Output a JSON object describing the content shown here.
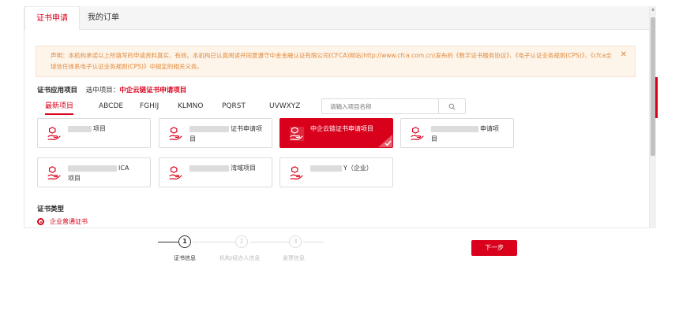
{
  "tabs": [
    {
      "label": "证书申请",
      "active": true
    },
    {
      "label": "我的订单",
      "active": false
    }
  ],
  "notice": {
    "text": "声明：本机构承诺以上所填写的申请资料真实、有效。本机构已认真阅读并同意遵守中金金融认证有限公司(CFCA)网站(http://www.cfca.com.cn)发布的《数字证书服务协议》、《电子认证业务规则(CPS)》、《cfca全球信任体系电子认证业务规则(CPS)》中规定的相关义务。",
    "close_icon": "close-icon"
  },
  "project": {
    "label": "证书应用项目",
    "selected_prefix": "选中项目：",
    "selected_value": "中企云链证书申请项目"
  },
  "letters": [
    {
      "label": "最新项目",
      "active": true
    },
    {
      "label": "ABCDE",
      "active": false
    },
    {
      "label": "FGHIJ",
      "active": false
    },
    {
      "label": "KLMNO",
      "active": false
    },
    {
      "label": "PQRST",
      "active": false
    },
    {
      "label": "UVWXYZ",
      "active": false
    }
  ],
  "search": {
    "placeholder": "请输入项目名称",
    "icon": "search-icon"
  },
  "cards": [
    {
      "line1": "项目",
      "line2": "",
      "selected": false
    },
    {
      "line1": "证书申请项",
      "line2": "目",
      "selected": false
    },
    {
      "line1": "中企云链证书申请项目",
      "line2": "",
      "selected": true
    },
    {
      "line1": "申请项",
      "line2": "目",
      "selected": false
    },
    {
      "line1": "ICA",
      "line2": "项目",
      "selected": false
    },
    {
      "line1": "湾域项目",
      "line2": "",
      "selected": false
    },
    {
      "line1": "Y（企业）",
      "line2": "",
      "selected": false
    }
  ],
  "cert_type": {
    "title": "证书类型",
    "option": "企业普通证书"
  },
  "steps": [
    {
      "num": "1",
      "label": "证书信息",
      "active": true
    },
    {
      "num": "2",
      "label": "机构/经办人信息",
      "active": false
    },
    {
      "num": "3",
      "label": "发票信息",
      "active": false
    }
  ],
  "next_button": "下一步",
  "colors": {
    "accent": "#d9001b",
    "notice_bg": "#fdf4ea",
    "notice_text": "#e08a3a"
  }
}
